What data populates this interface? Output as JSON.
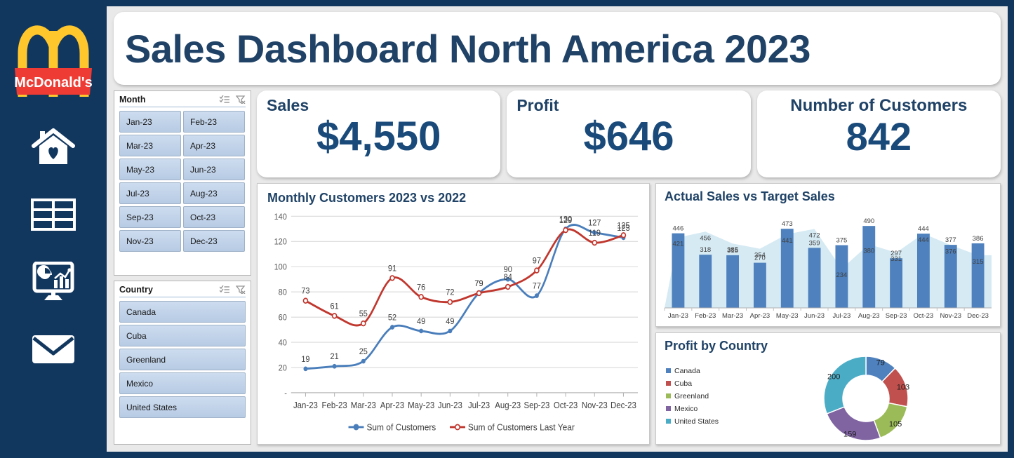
{
  "brand": {
    "name": "McDonald's",
    "logo_icon": "mcdonalds-golden-arches-logo",
    "arch_color": "#FFC72C",
    "banner_color": "#EE3B33"
  },
  "sidebar": {
    "items": [
      {
        "icon": "home-heart-icon",
        "name": "home"
      },
      {
        "icon": "table-icon",
        "name": "data-table"
      },
      {
        "icon": "dashboard-monitor-icon",
        "name": "dashboard"
      },
      {
        "icon": "envelope-icon",
        "name": "mail"
      }
    ]
  },
  "header": {
    "title": "Sales Dashboard North America 2023"
  },
  "slicers": {
    "month": {
      "title": "Month",
      "multi_select_icon": "multi-select-icon",
      "clear_filter_icon": "clear-filter-icon",
      "items": [
        "Jan-23",
        "Feb-23",
        "Mar-23",
        "Apr-23",
        "May-23",
        "Jun-23",
        "Jul-23",
        "Aug-23",
        "Sep-23",
        "Oct-23",
        "Nov-23",
        "Dec-23"
      ]
    },
    "country": {
      "title": "Country",
      "multi_select_icon": "multi-select-icon",
      "clear_filter_icon": "clear-filter-icon",
      "items": [
        "Canada",
        "Cuba",
        "Greenland",
        "Mexico",
        "United States"
      ]
    }
  },
  "kpis": [
    {
      "label": "Sales",
      "value": "$4,550",
      "name": "sales"
    },
    {
      "label": "Profit",
      "value": "$646",
      "name": "profit"
    },
    {
      "label": "Number of Customers",
      "value": "842",
      "name": "customers"
    }
  ],
  "colors": {
    "navy": "#12375f",
    "title_blue": "#1f4266",
    "series_blue": "#4a7ebb",
    "series_red": "#c0372e",
    "bar_blue": "#4e81bd",
    "area_blue": "#d6eaf4"
  },
  "chart_data": [
    {
      "type": "line",
      "name": "monthly-customers",
      "title": "Monthly Customers 2023 vs 2022",
      "categories": [
        "Jan-23",
        "Feb-23",
        "Mar-23",
        "Apr-23",
        "May-23",
        "Jun-23",
        "Jul-23",
        "Aug-23",
        "Sep-23",
        "Oct-23",
        "Nov-23",
        "Dec-23"
      ],
      "series": [
        {
          "name": "Sum of Customers",
          "color": "#4a7ebb",
          "values": [
            19,
            21,
            25,
            52,
            49,
            49,
            79,
            90,
            77,
            130,
            127,
            123
          ]
        },
        {
          "name": "Sum of Customers Last Year",
          "color": "#c0372e",
          "values": [
            73,
            61,
            55,
            91,
            76,
            72,
            79,
            84,
            97,
            129,
            119,
            125
          ]
        }
      ],
      "ylim": [
        0,
        140
      ],
      "yticks": [
        0,
        20,
        40,
        60,
        80,
        100,
        120,
        140
      ],
      "xlabel": "",
      "ylabel": "",
      "grid": true,
      "legend_position": "bottom"
    },
    {
      "type": "bar",
      "name": "actual-vs-target-sales",
      "title": "Actual Sales vs Target Sales",
      "categories": [
        "Jan-23",
        "Feb-23",
        "Mar-23",
        "Apr-23",
        "May-23",
        "Jun-23",
        "Jul-23",
        "Aug-23",
        "Sep-23",
        "Oct-23",
        "Nov-23",
        "Dec-23"
      ],
      "series": [
        {
          "name": "Actual Sales",
          "type": "bar",
          "color": "#4e81bd",
          "values": [
            446,
            318,
            315,
            270,
            473,
            359,
            375,
            490,
            297,
            444,
            377,
            386
          ]
        },
        {
          "name": "Target Sales",
          "type": "area",
          "color": "#d6eaf4",
          "values": [
            421,
            456,
            385,
            354,
            441,
            472,
            234,
            380,
            331,
            444,
            376,
            315
          ]
        }
      ],
      "ylim": [
        0,
        520
      ],
      "grid": false,
      "legend_position": "none"
    },
    {
      "type": "pie",
      "name": "profit-by-country",
      "title": "Profit by Country",
      "subtype": "donut",
      "labels": [
        "Canada",
        "Cuba",
        "Greenland",
        "Mexico",
        "United States"
      ],
      "values": [
        79,
        103,
        105,
        159,
        200
      ],
      "colors": [
        "#4e81bd",
        "#c0504d",
        "#9bbb59",
        "#8064a2",
        "#4bacc6"
      ],
      "legend_position": "left"
    }
  ]
}
